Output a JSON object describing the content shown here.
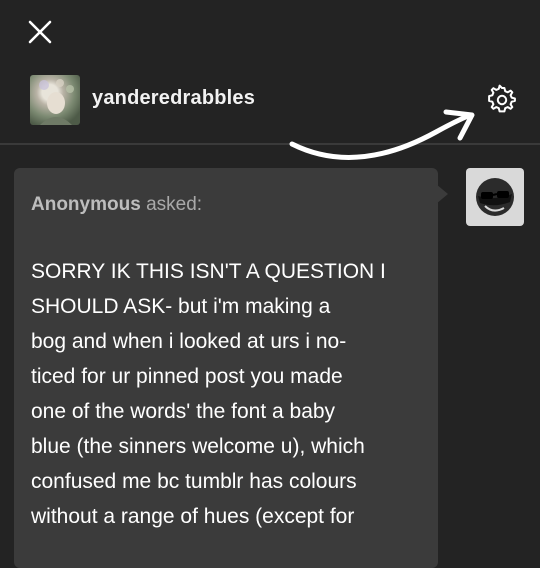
{
  "header": {
    "username": "yanderedrabbles"
  },
  "ask": {
    "asker_name": "Anonymous",
    "asker_suffix": "asked:",
    "question_lines": [
      "SORRY IK THIS ISN'T A QUESTION I",
      "SHOULD ASK- but i'm making a",
      "bog and when i looked at urs i no-",
      "ticed for ur pinned post you made",
      "one of the words' the font a baby",
      "blue (the sinners welcome u), which",
      "confused me bc tumblr has colours",
      "without a range of hues (except for"
    ]
  },
  "icons": {
    "close": "close-icon",
    "settings": "gear-icon",
    "annotation": "curved-arrow-icon",
    "anon_avatar": "anonymous-sunglasses-icon"
  },
  "colors": {
    "background": "#232323",
    "bubble": "#3b3b3b",
    "text": "#ffffff",
    "muted_text": "#a9a9a9"
  }
}
